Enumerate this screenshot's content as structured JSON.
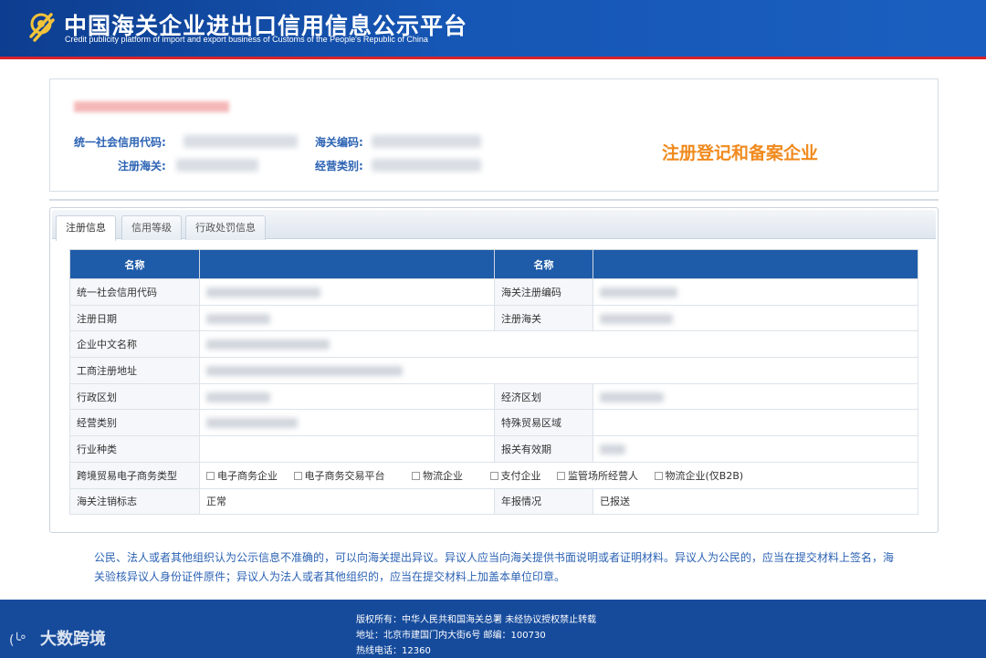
{
  "header": {
    "title_cn": "中国海关企业进出口信用信息公示平台",
    "title_en": "Credit publicity platform of import and export business of Customs of the People's Republic of China"
  },
  "company": {
    "name": "",
    "uscc_label": "统一社会信用代码:",
    "customs_code_label": "海关编码:",
    "reg_customs_label": "注册海关:",
    "biz_type_label": "经营类别:",
    "status_badge": "注册登记和备案企业"
  },
  "tabs": [
    {
      "label": "注册信息",
      "active": true
    },
    {
      "label": "信用等级",
      "active": false
    },
    {
      "label": "行政处罚信息",
      "active": false
    }
  ],
  "table": {
    "headers": [
      "名称",
      "",
      "名称",
      ""
    ],
    "rows": {
      "uscc": {
        "label": "统一社会信用代码",
        "label2": "海关注册编码"
      },
      "reg_date": {
        "label": "注册日期",
        "label2": "注册海关"
      },
      "cn_name": {
        "label": "企业中文名称"
      },
      "address": {
        "label": "工商注册地址"
      },
      "admin_area": {
        "label": "行政区划",
        "label2": "经济区划"
      },
      "biz_type": {
        "label": "经营类别",
        "label2": "特殊贸易区域"
      },
      "industry": {
        "label": "行业种类",
        "label2": "报关有效期"
      },
      "ecommerce": {
        "label": "跨境贸易电子商务类型",
        "options": [
          "电子商务企业",
          "电子商务交易平台",
          "物流企业",
          "支付企业",
          "监管场所经营人",
          "物流企业(仅B2B)"
        ]
      },
      "cancel": {
        "label": "海关注销标志",
        "value": "正常",
        "label2": "年报情况",
        "value2": "已报送"
      }
    }
  },
  "notice": "公民、法人或者其他组织认为公示信息不准确的，可以向海关提出异议。异议人应当向海关提供书面说明或者证明材料。异议人为公民的，应当在提交材料上签名，海关验核异议人身份证件原件；异议人为法人或者其他组织的，应当在提交材料上加盖本单位印章。",
  "footer": {
    "copyright": "版权所有：中华人民共和国海关总署   未经协议授权禁止转载",
    "address": "地址：北京市建国门内大街6号 邮编：100730",
    "hotline": "热线电话：12360"
  },
  "watermark": {
    "text": "大数跨境"
  },
  "colors": {
    "header_blue": "#1656b4",
    "table_header": "#1e5ba8",
    "badge_orange": "#f08a1e",
    "notice_blue": "#2b62b3"
  }
}
